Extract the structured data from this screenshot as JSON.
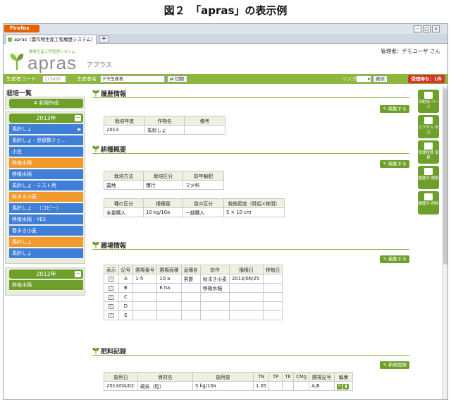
{
  "figure_title": "図２　「apras」の表示例",
  "browser": {
    "menu_button": "Firefox",
    "tab_title": "apras（農作物生産工程履歴システム）",
    "new_tab": "+",
    "window_controls": [
      "-",
      "□",
      "×"
    ]
  },
  "header": {
    "logo_subtitle": "農業生産工程管理システム",
    "logo_text": "apras",
    "logo_kana": "アプラス",
    "manager": "管理者：デモユーザ さん"
  },
  "toolbar": {
    "producer_code_label": "生産者コード",
    "producer_code_value": "123456",
    "producer_name_label": "生産者名",
    "producer_name_value": "デモ生産者",
    "switch_label": "切替",
    "link_label": "リンク:",
    "link_select": "",
    "show_button": "表示",
    "inbox_badge": "受理待ち：1件"
  },
  "sidebar": {
    "title": "栽培一覧",
    "new_button": "新規作成",
    "year_2013": "2013年",
    "year_2012": "2012年",
    "toggle": "−",
    "crops_2013": [
      {
        "label": "馬鈴しょ",
        "color": "#3f7fd8",
        "arrow": true
      },
      {
        "label": "馬鈴しょ - 登録数テェ…",
        "color": "#3f7fd8"
      },
      {
        "label": "小豆",
        "color": "#3f7fd8"
      },
      {
        "label": "移植水稲",
        "color": "#f39a2e"
      },
      {
        "label": "移植水稲",
        "color": "#3f7fd8"
      },
      {
        "label": "馬鈴しょ - テスト用",
        "color": "#3f7fd8"
      },
      {
        "label": "秋まき小麦",
        "color": "#f39a2e"
      },
      {
        "label": "馬鈴しょ - （コピー）",
        "color": "#3f7fd8"
      },
      {
        "label": "移植水稲 - YES",
        "color": "#3f7fd8"
      },
      {
        "label": "春まき小麦",
        "color": "#3f7fd8"
      },
      {
        "label": "馬鈴しょ",
        "color": "#f39a2e"
      },
      {
        "label": "馬鈴しょ",
        "color": "#3f7fd8"
      }
    ],
    "crops_2012": [
      {
        "label": "移植水稲",
        "color": "#6e9f2a"
      }
    ]
  },
  "history": {
    "title": "履歴情報",
    "edit": "編集する",
    "headers": [
      "栽培年度",
      "作物名",
      "備考"
    ],
    "row": [
      "2013",
      "馬鈴しょ",
      ""
    ]
  },
  "overview": {
    "title": "耕種概要",
    "edit": "編集する",
    "headers1": [
      "栽培方法",
      "栽培区分",
      "前年輪肥"
    ],
    "row1": [
      "露地",
      "慣行",
      "マメ科"
    ],
    "headers2": [
      "種の区分",
      "播種量",
      "苗の区分",
      "栽植密度（畦幅×株間）"
    ],
    "row2": [
      "全量購入",
      "10 kg/10a",
      "一部購入",
      "5 × 10 cm"
    ]
  },
  "field": {
    "title": "圃場情報",
    "edit": "編集する",
    "headers": [
      "表示",
      "記号",
      "圃場番号",
      "圃場面積",
      "品種名",
      "前作",
      "播種日",
      "移植日"
    ],
    "rows": [
      [
        "✓",
        "A",
        "1-5",
        "10 a",
        "男爵",
        "秋まき小麦",
        "2013/06/25",
        ""
      ],
      [
        "✓",
        "B",
        "",
        "6 ha",
        "",
        "移植水稲",
        "",
        ""
      ],
      [
        "✓",
        "C",
        "",
        "",
        "",
        "",
        "",
        ""
      ],
      [
        "✓",
        "D",
        "",
        "",
        "",
        "",
        "",
        ""
      ],
      [
        "✓",
        "E",
        "",
        "",
        "",
        "",
        "",
        ""
      ]
    ]
  },
  "fertilizer": {
    "title": "肥料記録",
    "new": "新規登録",
    "headers": [
      "施用日",
      "資材名",
      "施用量",
      "TN",
      "TP",
      "TK",
      "CMg",
      "圃場記号",
      "編集"
    ],
    "row": [
      "2013/04/02",
      "硫安（粒）",
      "5 kg/10a",
      "1.05",
      "",
      "",
      "",
      "A,B",
      ""
    ]
  },
  "right_actions": [
    {
      "label": "印刷用 ページ",
      "icon": "printer-icon"
    },
    {
      "label": "エクセル 出力",
      "icon": "excel-icon"
    },
    {
      "label": "受理状態 変更",
      "icon": "swap-icon"
    },
    {
      "label": "履歴の 複製",
      "icon": "copy-icon"
    },
    {
      "label": "履歴の 削除",
      "icon": "trash-icon"
    }
  ]
}
